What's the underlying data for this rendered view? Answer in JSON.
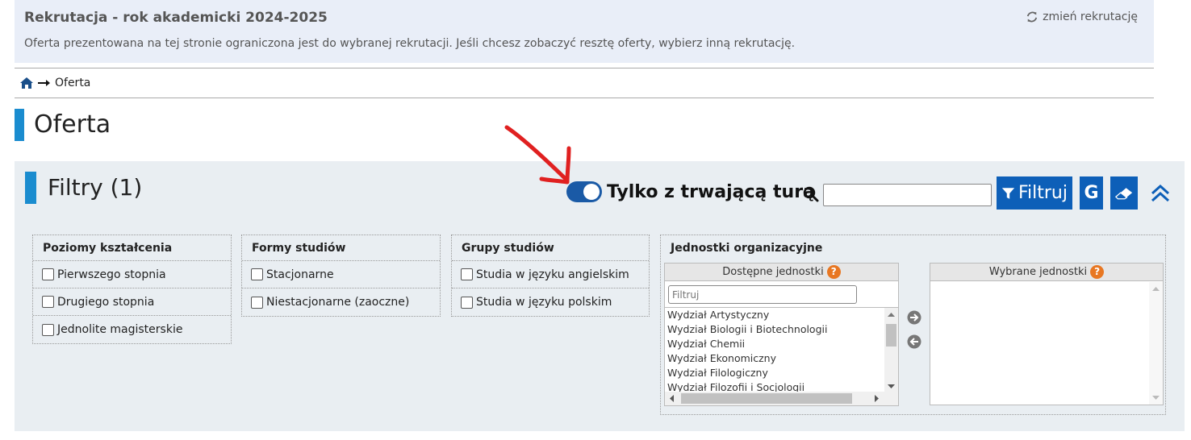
{
  "banner": {
    "title": "Rekrutacja - rok akademicki 2024-2025",
    "description": "Oferta prezentowana na tej stronie ograniczona jest do wybranej rekrutacji. Jeśli chcesz zobaczyć resztę oferty, wybierz inną rekrutację.",
    "change_label": "zmień rekrutację",
    "change_icon": "refresh-icon"
  },
  "breadcrumb": {
    "home_icon": "home-icon",
    "separator_icon": "arrow-right-icon",
    "current": "Oferta"
  },
  "page": {
    "title": "Oferta"
  },
  "filters": {
    "title": "Filtry (1)",
    "toggle": {
      "label": "Tylko z trwającą turą",
      "checked": true
    },
    "search": {
      "value": "",
      "placeholder": ""
    },
    "filter_button": "Filtruj",
    "g_button": "G",
    "colors": {
      "accent": "#1a8ccf",
      "button": "#0d5fb8",
      "panel": "#e9eef2",
      "toggle": "#1a5aa6",
      "annotation": "#e02020"
    },
    "groups": [
      {
        "header": "Poziomy kształcenia",
        "items": [
          "Pierwszego stopnia",
          "Drugiego stopnia",
          "Jednolite magisterskie"
        ]
      },
      {
        "header": "Formy studiów",
        "items": [
          "Stacjonarne",
          "Niestacjonarne (zaoczne)"
        ]
      },
      {
        "header": "Grupy studiów",
        "items": [
          "Studia w języku angielskim",
          "Studia w języku polskim"
        ]
      }
    ],
    "units": {
      "header": "Jednostki organizacyjne",
      "available_header": "Dostępne jednostki",
      "filter_placeholder": "Filtruj",
      "available": [
        "Wydział Artystyczny",
        "Wydział Biologii i Biotechnologii",
        "Wydział Chemii",
        "Wydział Ekonomiczny",
        "Wydział Filologiczny",
        "Wydział Filozofii i Socjologii"
      ],
      "selected_header": "Wybrane jednostki",
      "help_glyph": "?"
    }
  }
}
